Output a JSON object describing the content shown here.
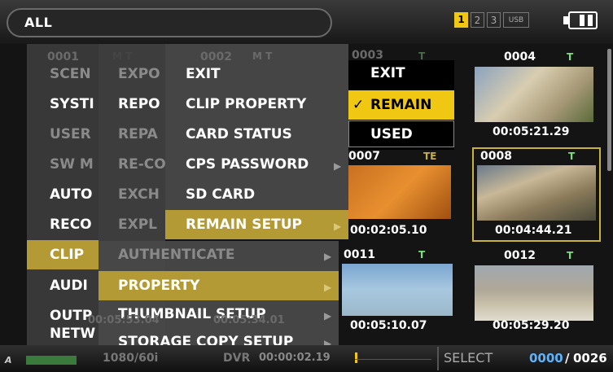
{
  "top_bar": {
    "filter": "ALL",
    "slots": [
      "1",
      "2",
      "3",
      "USB"
    ],
    "active_slot": "1"
  },
  "thumbnails": [
    {
      "number": "0001",
      "flags": "M T"
    },
    {
      "number": "0002",
      "flags": "M T"
    },
    {
      "number": "0003",
      "flags": "T"
    },
    {
      "number": "0004",
      "flags": "T",
      "time": "00:05:21.29"
    },
    {
      "number": "0007",
      "flags": "TE",
      "time": "00:02:05.10"
    },
    {
      "number": "0008",
      "flags": "T",
      "time": "00:04:44.21"
    },
    {
      "number": "0011",
      "flags": "T",
      "time": "00:05:10.07"
    },
    {
      "number": "0012",
      "flags": "T",
      "time": "00:05:29.20"
    }
  ],
  "ghost_text": {
    "t1": "00:05:53.04",
    "t2": "00:05:34.01",
    "t3": "00:00:02.19",
    "fmt": "1080/60i",
    "dvr": "DVR"
  },
  "menu_level1": [
    "SCENE FILE",
    "SYSTEM",
    "USER SW",
    "SW MODE",
    "AUTO SW",
    "RECORDING",
    "CLIP",
    "AUDIO",
    "OUTPUT",
    "NETWORK"
  ],
  "menu_level1_visible": [
    "SCEN",
    "SYSTI",
    "USER",
    "SW M",
    "AUTO",
    "RECO",
    "CLIP",
    "AUDI",
    "OUTP",
    "NETW"
  ],
  "menu_level1_selected": "CLIP",
  "menu_level2": [
    "EXPO",
    "REPO",
    "REPA",
    "RE-CO",
    "EXCH",
    "EXPL",
    "AUTHENTICATE",
    "PROPERTY",
    "THUMBNAIL SETUP",
    "STORAGE COPY SETUP"
  ],
  "menu_level2_selected": "PROPERTY",
  "menu_level3": [
    "EXIT",
    "CLIP PROPERTY",
    "CARD STATUS",
    "CPS PASSWORD",
    "SD CARD",
    "REMAIN SETUP"
  ],
  "menu_level3_selected": "REMAIN SETUP",
  "menu_level4": [
    "EXIT",
    "REMAIN",
    "USED"
  ],
  "menu_level4_checked": "REMAIN",
  "bottom_bar": {
    "select_label": "SELECT",
    "selected_count": "0000",
    "total_count": "0026"
  },
  "colors": {
    "highlight": "#b39a35",
    "selected_yellow": "#f0c814",
    "thumb_border_selected": "#c8b43c",
    "count_blue": "#5ab4ff"
  }
}
